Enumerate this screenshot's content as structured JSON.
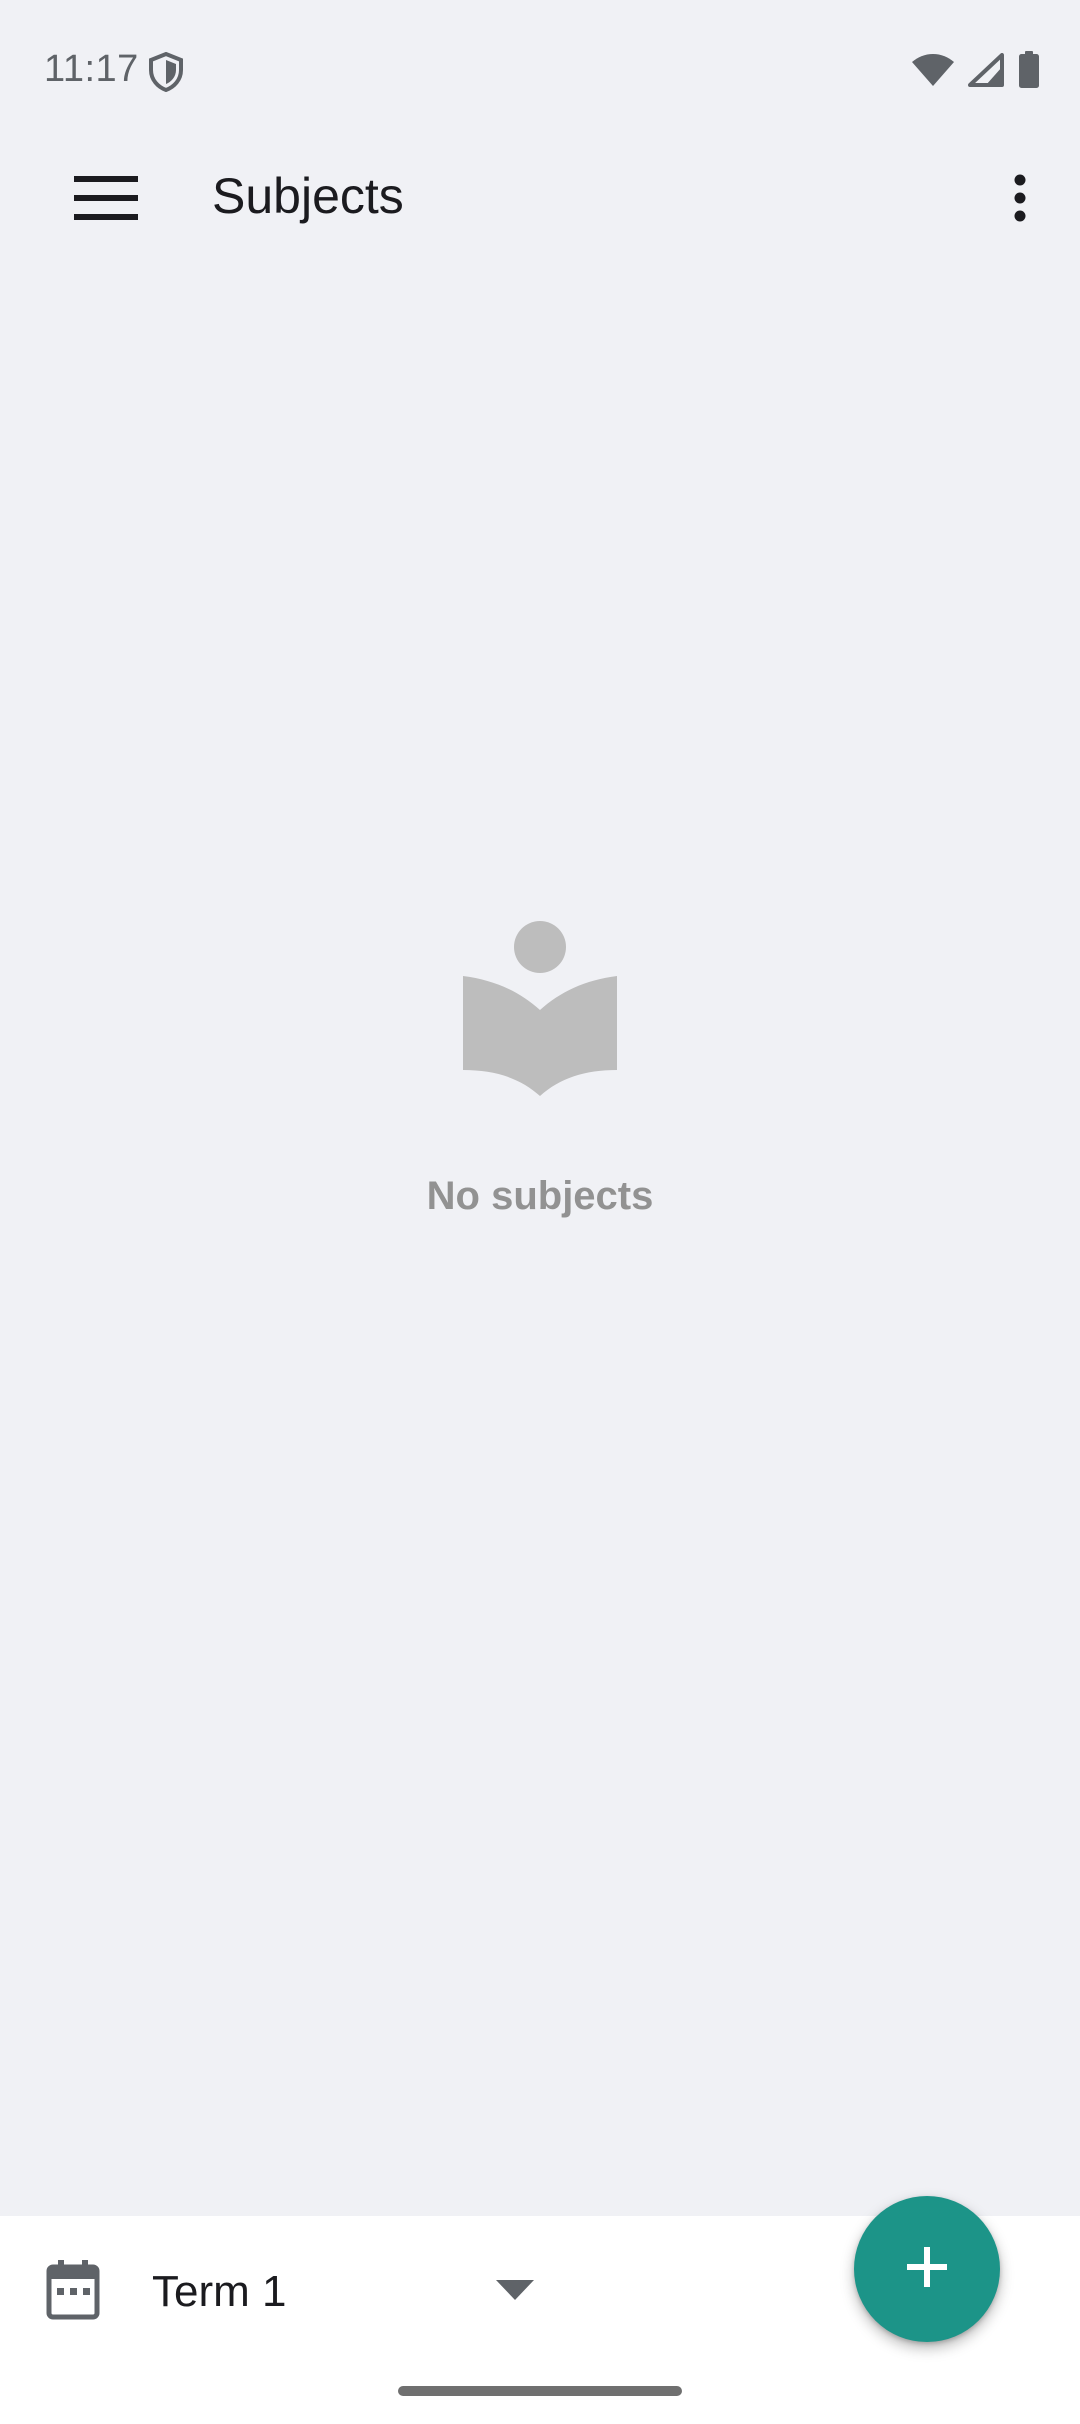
{
  "status_bar": {
    "time": "11:17",
    "icons": [
      "shield-icon",
      "wifi-icon",
      "cell-signal-icon",
      "battery-icon"
    ]
  },
  "app_bar": {
    "title": "Subjects",
    "menu_icon": "hamburger-menu-icon",
    "overflow_icon": "more-vert-icon"
  },
  "empty_state": {
    "icon": "book-reader-icon",
    "message": "No subjects"
  },
  "bottom_bar": {
    "calendar_icon": "calendar-icon",
    "term_selected": "Term 1",
    "dropdown_icon": "arrow-drop-down-icon"
  },
  "fab": {
    "icon": "plus-icon"
  },
  "colors": {
    "background": "#f0f1f5",
    "accent": "#1c9488",
    "empty_gray": "#bdbdbd",
    "empty_text": "#929292"
  }
}
